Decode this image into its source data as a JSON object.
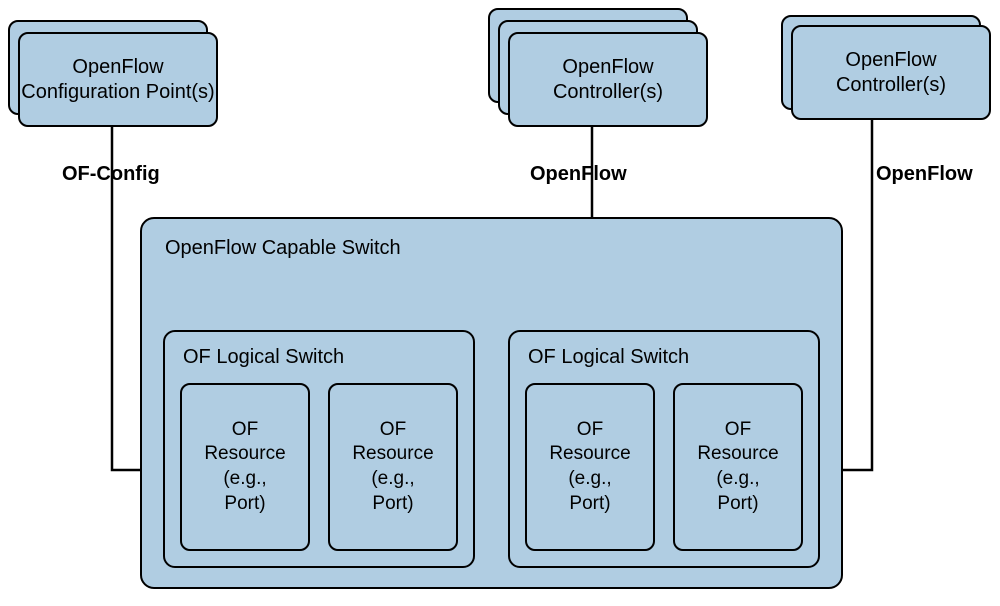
{
  "diagram": {
    "nodes": {
      "config_point": {
        "line1": "OpenFlow",
        "line2": "Configuration Point(s)"
      },
      "controller_mid": {
        "line1": "OpenFlow",
        "line2": "Controller(s)"
      },
      "controller_right": {
        "line1": "OpenFlow",
        "line2": "Controller(s)"
      },
      "capable_switch": {
        "title": "OpenFlow Capable Switch"
      },
      "logical_switch_left": {
        "title": "OF Logical Switch"
      },
      "logical_switch_right": {
        "title": "OF Logical Switch"
      },
      "resource": {
        "line1": "OF",
        "line2": "Resource",
        "line3": "(e.g.,",
        "line4": "Port)"
      }
    },
    "edges": {
      "of_config": "OF-Config",
      "openflow_mid": "OpenFlow",
      "openflow_right": "OpenFlow"
    }
  }
}
